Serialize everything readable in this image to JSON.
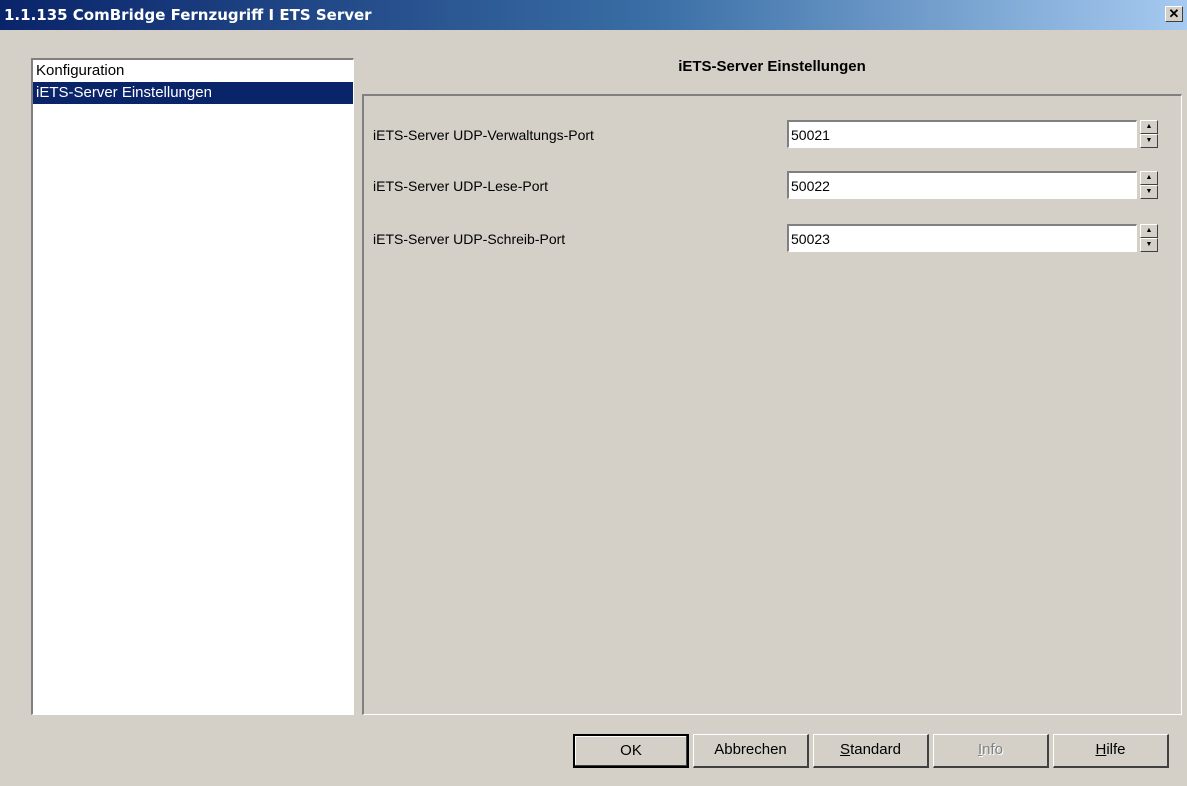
{
  "window": {
    "title": "1.1.135 ComBridge Fernzugriff I ETS Server",
    "close_symbol": "✕"
  },
  "nav": {
    "items": [
      {
        "label": "Konfiguration",
        "selected": false
      },
      {
        "label": "iETS-Server Einstellungen",
        "selected": true
      }
    ]
  },
  "panel": {
    "heading": "iETS-Server Einstellungen",
    "params": [
      {
        "label": "iETS-Server UDP-Verwaltungs-Port",
        "value": "50021"
      },
      {
        "label": "iETS-Server UDP-Lese-Port",
        "value": "50022"
      },
      {
        "label": "iETS-Server UDP-Schreib-Port",
        "value": "50023"
      }
    ]
  },
  "buttons": {
    "ok": "OK",
    "cancel": "Abbrechen",
    "standard_first": "S",
    "standard_rest": "tandard",
    "info_first": "I",
    "info_rest": "nfo",
    "help_first": "H",
    "help_rest": "ilfe",
    "info_enabled": false
  },
  "icons": {
    "close": "close-icon",
    "spin_up": "arrow-up-icon",
    "spin_down": "arrow-down-icon"
  },
  "colors": {
    "titlebar_start": "#0a246a",
    "titlebar_end": "#a6caf0",
    "selection": "#0a246a",
    "dialog_bg": "#d4d0c8"
  }
}
